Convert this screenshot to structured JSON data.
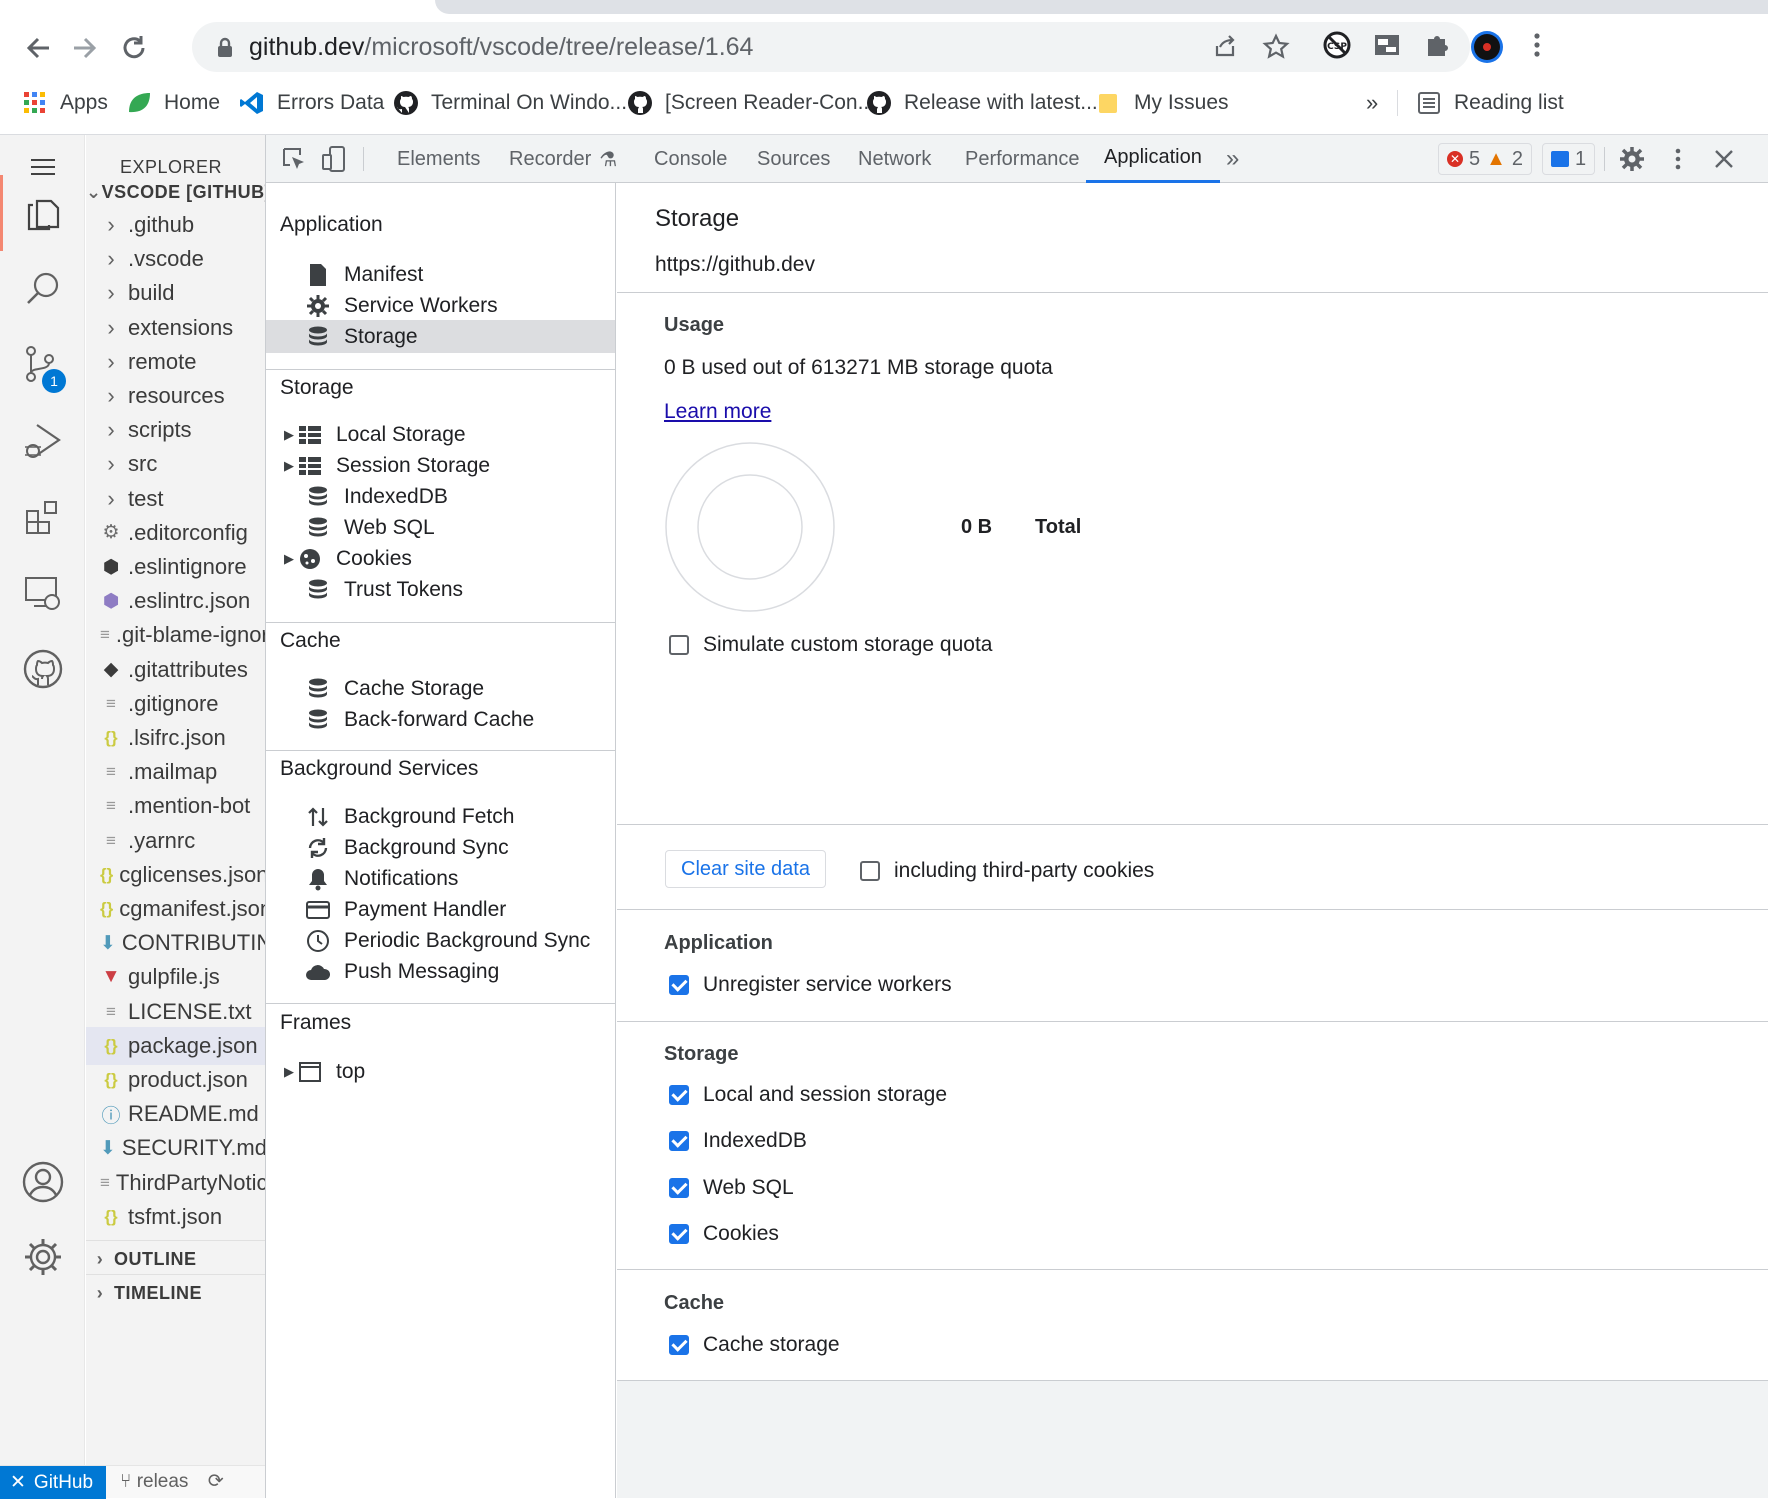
{
  "browser": {
    "url_host": "github.dev",
    "url_path": "/microsoft/vscode/tree/release/1.64",
    "bookmarks": [
      {
        "label": "Apps",
        "icon": "apps-grid-icon"
      },
      {
        "label": "Home",
        "icon": "home-leaf-icon"
      },
      {
        "label": "Errors Data",
        "icon": "vscode-icon"
      },
      {
        "label": "Terminal On Windo...",
        "icon": "github-icon"
      },
      {
        "label": "[Screen Reader-Con...",
        "icon": "github-icon"
      },
      {
        "label": "Release with latest...",
        "icon": "github-icon"
      },
      {
        "label": "My Issues",
        "icon": "folder-icon"
      }
    ],
    "overflow_label": "»",
    "reading_list": "Reading list"
  },
  "vscode": {
    "explorer_title": "EXPLORER",
    "root_folder": "VSCODE [GITHUB]",
    "scm_badge": "1",
    "files": [
      {
        "name": ".github",
        "type": "folder"
      },
      {
        "name": ".vscode",
        "type": "folder"
      },
      {
        "name": "build",
        "type": "folder"
      },
      {
        "name": "extensions",
        "type": "folder"
      },
      {
        "name": "remote",
        "type": "folder"
      },
      {
        "name": "resources",
        "type": "folder"
      },
      {
        "name": "scripts",
        "type": "folder"
      },
      {
        "name": "src",
        "type": "folder"
      },
      {
        "name": "test",
        "type": "folder"
      },
      {
        "name": ".editorconfig",
        "type": "gear"
      },
      {
        "name": ".eslintignore",
        "type": "eslint-dark"
      },
      {
        "name": ".eslintrc.json",
        "type": "eslint"
      },
      {
        "name": ".git-blame-ignore",
        "type": "lines"
      },
      {
        "name": ".gitattributes",
        "type": "git"
      },
      {
        "name": ".gitignore",
        "type": "lines"
      },
      {
        "name": ".lsifrc.json",
        "type": "json"
      },
      {
        "name": ".mailmap",
        "type": "lines"
      },
      {
        "name": ".mention-bot",
        "type": "lines"
      },
      {
        "name": ".yarnrc",
        "type": "lines"
      },
      {
        "name": "cglicenses.json",
        "type": "json"
      },
      {
        "name": "cgmanifest.json",
        "type": "json"
      },
      {
        "name": "CONTRIBUTING.md",
        "type": "download"
      },
      {
        "name": "gulpfile.js",
        "type": "gulp"
      },
      {
        "name": "LICENSE.txt",
        "type": "lines"
      },
      {
        "name": "package.json",
        "type": "json",
        "selected": true
      },
      {
        "name": "product.json",
        "type": "json"
      },
      {
        "name": "README.md",
        "type": "info"
      },
      {
        "name": "SECURITY.md",
        "type": "download"
      },
      {
        "name": "ThirdPartyNotices",
        "type": "lines"
      },
      {
        "name": "tsfmt.json",
        "type": "json"
      }
    ],
    "outline": "OUTLINE",
    "timeline": "TIMELINE",
    "status_remote": "GitHub",
    "status_branch": "releas"
  },
  "devtools": {
    "tabs": [
      "Elements",
      "Recorder",
      "Console",
      "Sources",
      "Network",
      "Performance",
      "Application"
    ],
    "active_tab": "Application",
    "errors": "5",
    "warnings": "2",
    "messages": "1",
    "sidebar": {
      "application_head": "Application",
      "application_items": [
        "Manifest",
        "Service Workers",
        "Storage"
      ],
      "storage_head": "Storage",
      "storage_items": [
        "Local Storage",
        "Session Storage",
        "IndexedDB",
        "Web SQL",
        "Cookies",
        "Trust Tokens"
      ],
      "cache_head": "Cache",
      "cache_items": [
        "Cache Storage",
        "Back-forward Cache"
      ],
      "bg_head": "Background Services",
      "bg_items": [
        "Background Fetch",
        "Background Sync",
        "Notifications",
        "Payment Handler",
        "Periodic Background Sync",
        "Push Messaging"
      ],
      "frames_head": "Frames",
      "frames_items": [
        "top"
      ]
    },
    "main": {
      "title": "Storage",
      "origin": "https://github.dev",
      "usage_head": "Usage",
      "usage_text": "0 B used out of 613271 MB storage quota",
      "learn_more": "Learn more",
      "total_value": "0 B",
      "total_label": "Total",
      "simulate_label": "Simulate custom storage quota",
      "clear_button": "Clear site data",
      "third_party_label": "including third-party cookies",
      "app_head": "Application",
      "unregister_label": "Unregister service workers",
      "storage_head": "Storage",
      "storage_checks": [
        "Local and session storage",
        "IndexedDB",
        "Web SQL",
        "Cookies"
      ],
      "cache_head": "Cache",
      "cache_check": "Cache storage"
    }
  }
}
